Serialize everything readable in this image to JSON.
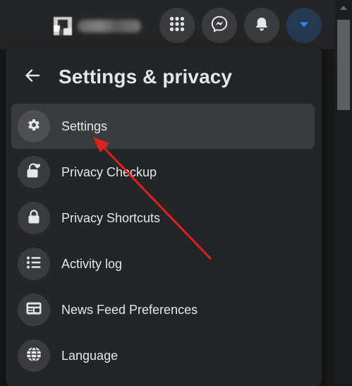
{
  "topbar": {
    "icons": [
      "menu-grid-icon",
      "messenger-icon",
      "bell-icon",
      "caret-down-icon"
    ]
  },
  "panel": {
    "title": "Settings & privacy",
    "items": [
      {
        "label": "Settings",
        "icon": "gear-icon",
        "highlighted": true
      },
      {
        "label": "Privacy Checkup",
        "icon": "lock-heart-icon"
      },
      {
        "label": "Privacy Shortcuts",
        "icon": "lock-icon"
      },
      {
        "label": "Activity log",
        "icon": "list-icon"
      },
      {
        "label": "News Feed Preferences",
        "icon": "news-feed-icon"
      },
      {
        "label": "Language",
        "icon": "globe-icon"
      }
    ]
  },
  "colors": {
    "background": "#18191a",
    "surface": "#242526",
    "hover": "#3a3b3c",
    "text": "#e4e6eb",
    "accent": "#2d88ff",
    "annotation_arrow": "#e0201f"
  }
}
